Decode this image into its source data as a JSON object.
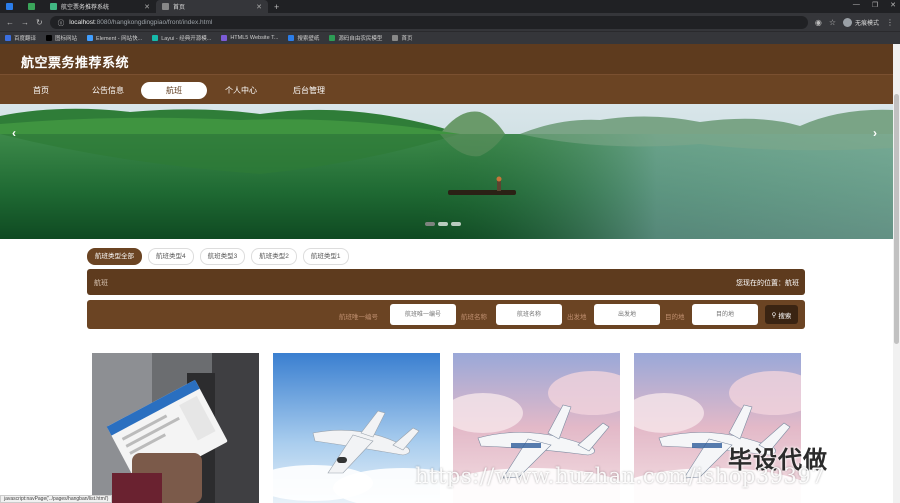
{
  "browser": {
    "tabs": [
      {
        "title": "航空票务推荐系统",
        "icon_color": "#41b883"
      },
      {
        "title": "首页",
        "icon_color": "#888888"
      }
    ],
    "url_host": "localhost",
    "url_path": ":8080/hangkongdingpiao/front/index.html",
    "profile_label": "无痕模式",
    "bookmarks": [
      {
        "label": "百度翻译",
        "color": "#3b6fe0"
      },
      {
        "label": "图标网站",
        "color": "#000000"
      },
      {
        "label": "Element - 网站快...",
        "color": "#409eff"
      },
      {
        "label": "Layui - 经典开源模...",
        "color": "#16baaa"
      },
      {
        "label": "HTML5 Website T...",
        "color": "#7b5bd6"
      },
      {
        "label": "搜索壁纸",
        "color": "#2b7de9"
      },
      {
        "label": "源码自由农民模型",
        "color": "#2d9c55"
      },
      {
        "label": "首页",
        "color": "#888888"
      }
    ]
  },
  "site": {
    "title": "航空票务推荐系统",
    "nav": [
      "首页",
      "公告信息",
      "航班",
      "个人中心",
      "后台管理"
    ],
    "active_nav": "航班"
  },
  "banner": {
    "prev_label": "‹",
    "next_label": "›",
    "slide_count": 3,
    "active_slide": 1
  },
  "categories": [
    "航班类型全部",
    "航班类型4",
    "航班类型3",
    "航班类型2",
    "航班类型1"
  ],
  "location": {
    "left": "航班",
    "right": "您现在的位置：航班"
  },
  "search": {
    "fields": [
      {
        "label": "航班唯一编号",
        "placeholder": "航班唯一编号"
      },
      {
        "label": "航班名称",
        "placeholder": "航班名称"
      },
      {
        "label": "出发地",
        "placeholder": "出发地"
      },
      {
        "label": "目的地",
        "placeholder": "目的地"
      }
    ],
    "button_label": "搜索",
    "button_icon": "search-icon"
  },
  "cards": [
    {
      "image": "boarding-pass-photo"
    },
    {
      "image": "airplane-in-sky-photo"
    },
    {
      "image": "airplane-in-clouds-photo"
    },
    {
      "image": "airplane-in-clouds-photo"
    }
  ],
  "status_bar": "javascript:navPage('../pages/hangban/list.html')",
  "watermark": {
    "title": "毕设代做",
    "url": "https://www.huzhan.com/ishop39397"
  },
  "colors": {
    "header": "#5e3b1e",
    "nav": "#6b4423",
    "accent": "#3a2412"
  }
}
